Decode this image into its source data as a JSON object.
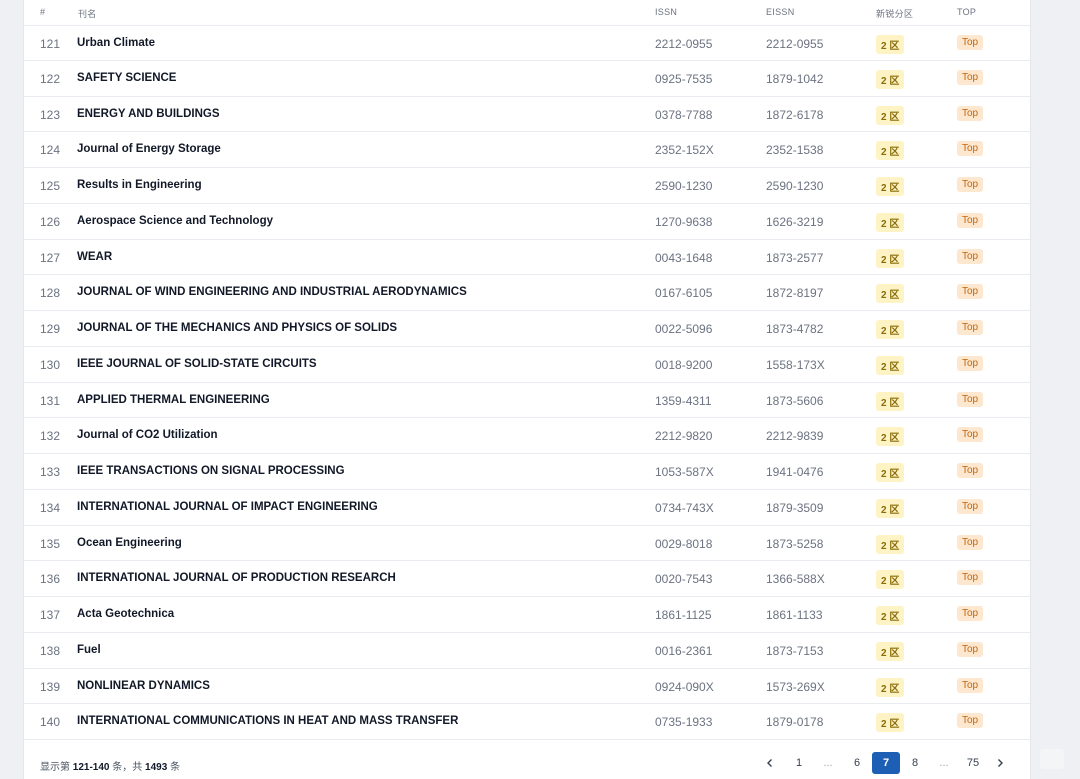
{
  "table": {
    "headers": {
      "num": "#",
      "name": "刊名",
      "issn": "ISSN",
      "eissn": "EISSN",
      "zone": "新锐分区",
      "top": "TOP"
    },
    "rows": [
      {
        "num": "121",
        "name": "Urban Climate",
        "issn": "2212-0955",
        "eissn": "2212-0955",
        "zone": "2 区",
        "top": "Top"
      },
      {
        "num": "122",
        "name": "SAFETY SCIENCE",
        "issn": "0925-7535",
        "eissn": "1879-1042",
        "zone": "2 区",
        "top": "Top"
      },
      {
        "num": "123",
        "name": "ENERGY AND BUILDINGS",
        "issn": "0378-7788",
        "eissn": "1872-6178",
        "zone": "2 区",
        "top": "Top"
      },
      {
        "num": "124",
        "name": "Journal of Energy Storage",
        "issn": "2352-152X",
        "eissn": "2352-1538",
        "zone": "2 区",
        "top": "Top"
      },
      {
        "num": "125",
        "name": "Results in Engineering",
        "issn": "2590-1230",
        "eissn": "2590-1230",
        "zone": "2 区",
        "top": "Top"
      },
      {
        "num": "126",
        "name": "Aerospace Science and Technology",
        "issn": "1270-9638",
        "eissn": "1626-3219",
        "zone": "2 区",
        "top": "Top"
      },
      {
        "num": "127",
        "name": "WEAR",
        "issn": "0043-1648",
        "eissn": "1873-2577",
        "zone": "2 区",
        "top": "Top"
      },
      {
        "num": "128",
        "name": "JOURNAL OF WIND ENGINEERING AND INDUSTRIAL AERODYNAMICS",
        "issn": "0167-6105",
        "eissn": "1872-8197",
        "zone": "2 区",
        "top": "Top"
      },
      {
        "num": "129",
        "name": "JOURNAL OF THE MECHANICS AND PHYSICS OF SOLIDS",
        "issn": "0022-5096",
        "eissn": "1873-4782",
        "zone": "2 区",
        "top": "Top"
      },
      {
        "num": "130",
        "name": "IEEE JOURNAL OF SOLID-STATE CIRCUITS",
        "issn": "0018-9200",
        "eissn": "1558-173X",
        "zone": "2 区",
        "top": "Top"
      },
      {
        "num": "131",
        "name": "APPLIED THERMAL ENGINEERING",
        "issn": "1359-4311",
        "eissn": "1873-5606",
        "zone": "2 区",
        "top": "Top"
      },
      {
        "num": "132",
        "name": "Journal of CO2 Utilization",
        "issn": "2212-9820",
        "eissn": "2212-9839",
        "zone": "2 区",
        "top": "Top"
      },
      {
        "num": "133",
        "name": "IEEE TRANSACTIONS ON SIGNAL PROCESSING",
        "issn": "1053-587X",
        "eissn": "1941-0476",
        "zone": "2 区",
        "top": "Top"
      },
      {
        "num": "134",
        "name": "INTERNATIONAL JOURNAL OF IMPACT ENGINEERING",
        "issn": "0734-743X",
        "eissn": "1879-3509",
        "zone": "2 区",
        "top": "Top"
      },
      {
        "num": "135",
        "name": "Ocean Engineering",
        "issn": "0029-8018",
        "eissn": "1873-5258",
        "zone": "2 区",
        "top": "Top"
      },
      {
        "num": "136",
        "name": "INTERNATIONAL JOURNAL OF PRODUCTION RESEARCH",
        "issn": "0020-7543",
        "eissn": "1366-588X",
        "zone": "2 区",
        "top": "Top"
      },
      {
        "num": "137",
        "name": "Acta Geotechnica",
        "issn": "1861-1125",
        "eissn": "1861-1133",
        "zone": "2 区",
        "top": "Top"
      },
      {
        "num": "138",
        "name": "Fuel",
        "issn": "0016-2361",
        "eissn": "1873-7153",
        "zone": "2 区",
        "top": "Top"
      },
      {
        "num": "139",
        "name": "NONLINEAR DYNAMICS",
        "issn": "0924-090X",
        "eissn": "1573-269X",
        "zone": "2 区",
        "top": "Top"
      },
      {
        "num": "140",
        "name": "INTERNATIONAL COMMUNICATIONS IN HEAT AND MASS TRANSFER",
        "issn": "0735-1933",
        "eissn": "1879-0178",
        "zone": "2 区",
        "top": "Top"
      }
    ]
  },
  "footer": {
    "summary_prefix": "显示第 ",
    "summary_range": "121-140",
    "summary_mid": " 条，共 ",
    "summary_total": "1493",
    "summary_suffix": " 条"
  },
  "pagination": {
    "pages": [
      "1",
      "...",
      "6",
      "7",
      "8",
      "...",
      "75"
    ],
    "current": "7",
    "prev_icon": "chevron-left-icon",
    "next_icon": "chevron-right-icon"
  },
  "colors": {
    "accent": "#1d5fb5",
    "zone_badge_bg": "#fdf3c4",
    "top_badge_bg": "#fde7cf"
  }
}
